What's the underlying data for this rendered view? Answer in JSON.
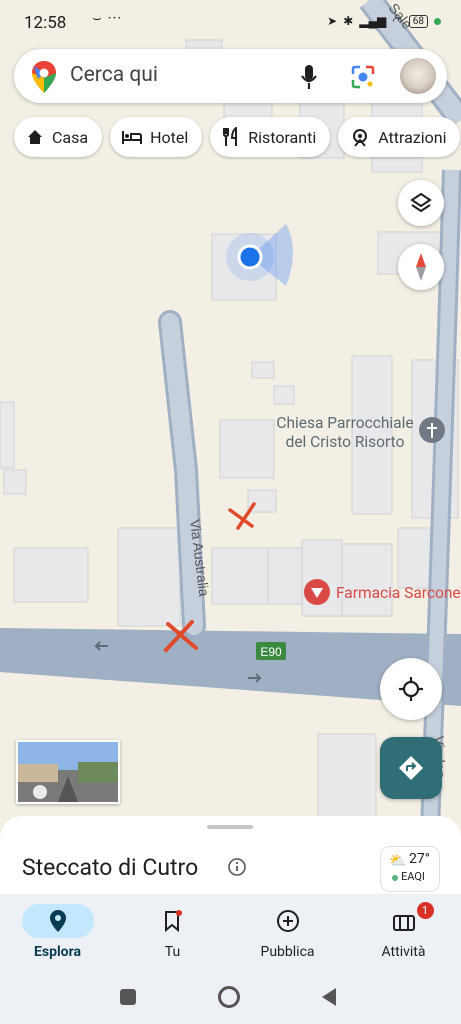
{
  "status": {
    "time": "12:58",
    "extra": "⌣ ···",
    "battery": "68"
  },
  "search": {
    "placeholder": "Cerca qui"
  },
  "chips": [
    {
      "label": "Casa",
      "icon": "home-icon"
    },
    {
      "label": "Hotel",
      "icon": "bed-icon"
    },
    {
      "label": "Ristoranti",
      "icon": "restaurant-icon"
    },
    {
      "label": "Attrazioni",
      "icon": "attraction-icon"
    }
  ],
  "map": {
    "road_top_right": "Sale",
    "via_australia": "Via Australia",
    "church": "Chiesa Parrocchiale\ndel Cristo Risorto",
    "pharmacy": "Farmacia Sarcone",
    "route_badge": "E90",
    "road_right": "Vi...lon"
  },
  "sheet": {
    "title": "Steccato di Cutro",
    "temp": "27°",
    "aqi": "EAQI"
  },
  "nav": [
    {
      "label": "Esplora",
      "icon": "explore-pin-icon",
      "active": true
    },
    {
      "label": "Tu",
      "icon": "saved-bookmark-icon"
    },
    {
      "label": "Pubblica",
      "icon": "add-circle-icon"
    },
    {
      "label": "Attività",
      "icon": "activity-icon",
      "badge": "1"
    }
  ],
  "colors": {
    "map_bg": "#f3efe4",
    "road": "#9fb0c4",
    "building": "#e8e8e9",
    "accent": "#1a73e8",
    "directions": "#2f6e76",
    "pharmacy": "#d94a46"
  }
}
